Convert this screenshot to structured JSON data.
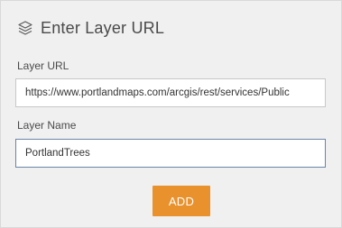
{
  "header": {
    "icon": "layers-icon",
    "title": "Enter Layer URL"
  },
  "form": {
    "url_label": "Layer URL",
    "url_value": "https://www.portlandmaps.com/arcgis/rest/services/Public",
    "name_label": "Layer Name",
    "name_value": "PortlandTrees",
    "add_label": "ADD"
  },
  "colors": {
    "accent_button": "#e8912d",
    "panel_bg": "#f0f0f0",
    "focused_border": "#6a84a8"
  }
}
